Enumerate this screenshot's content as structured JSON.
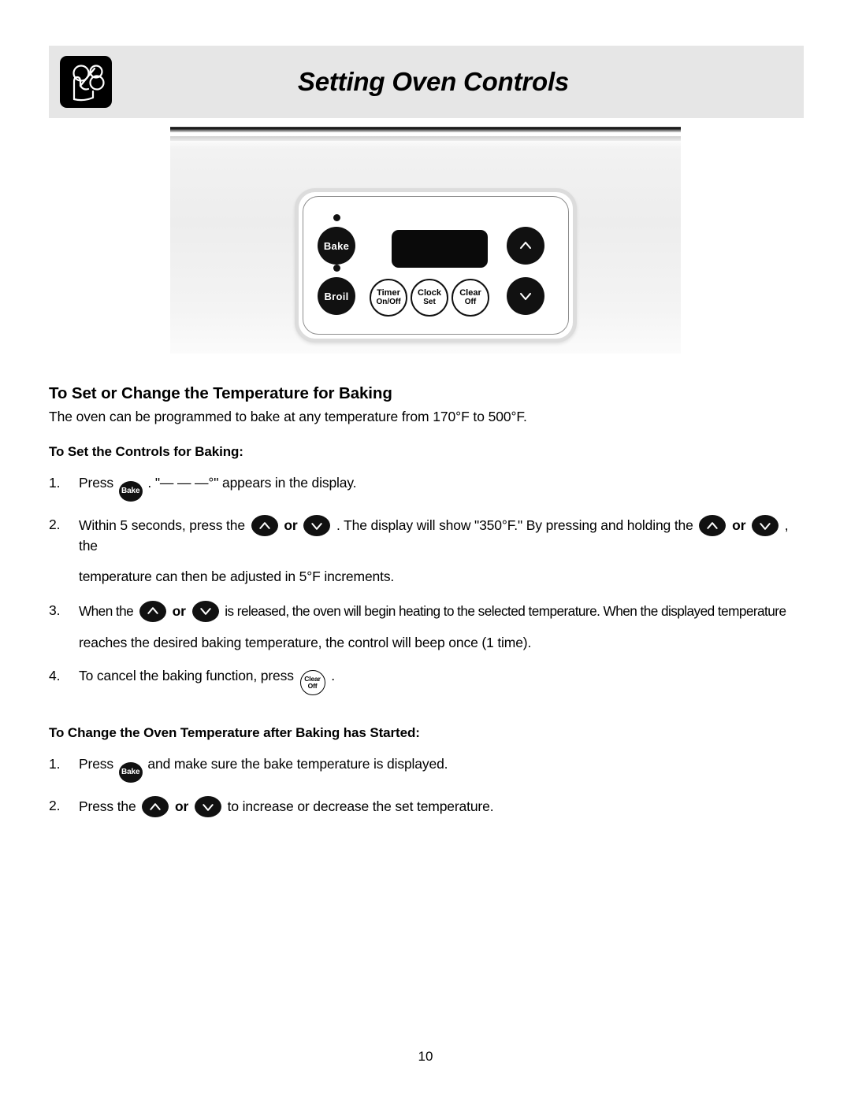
{
  "header": {
    "title": "Setting Oven Controls",
    "icon": "hand-pressing-controls-icon"
  },
  "illustration": {
    "name": "oven-control-panel-illustration",
    "display_value": "",
    "buttons": [
      {
        "id": "bake",
        "label": "Bake",
        "label2": "",
        "style": "dark"
      },
      {
        "id": "broil",
        "label": "Broil",
        "label2": "",
        "style": "dark"
      },
      {
        "id": "timer",
        "label": "Timer",
        "label2": "On/Off",
        "style": "light"
      },
      {
        "id": "clock",
        "label": "Clock",
        "label2": "Set",
        "style": "light"
      },
      {
        "id": "clear",
        "label": "Clear",
        "label2": "Off",
        "style": "light"
      },
      {
        "id": "up-arrow",
        "label": "∧",
        "label2": "",
        "style": "dark"
      },
      {
        "id": "down-arrow",
        "label": "∨",
        "label2": "",
        "style": "dark"
      }
    ]
  },
  "section1": {
    "title": "To Set or Change the Temperature for Baking",
    "lead": "The oven can be programmed to bake at any temperature from 170°F to 500°F.",
    "sub_title": "To Set the Controls for Baking:",
    "steps": [
      {
        "num": "1.",
        "a": "Press",
        "b": ". \"— — —°\" appears in the display."
      },
      {
        "num": "2.",
        "a": "Within 5 seconds, press the",
        "or": "or",
        "b": ". The display will show \"350°F.\" By pressing and holding the",
        "or2": "or",
        "c": ", the",
        "line2": "temperature can then be adjusted in 5°F increments."
      },
      {
        "num": "3.",
        "a": "When the",
        "or": "or",
        "b": "is released, the oven will begin heating to the selected temperature. When the displayed temperature",
        "line2": "reaches the desired baking temperature, the control will beep once (1 time)."
      },
      {
        "num": "4.",
        "a": "To cancel the baking function, press",
        "b": "."
      }
    ]
  },
  "section2": {
    "sub_title": "To Change the Oven Temperature after Baking has Started:",
    "steps": [
      {
        "num": "1.",
        "a": "Press",
        "b": "and make sure the bake temperature is displayed."
      },
      {
        "num": "2.",
        "a": "Press the",
        "or": "or",
        "b": "to increase or decrease the set temperature."
      }
    ]
  },
  "footer": {
    "page_number": "10"
  },
  "colors": {
    "header_band": "#e6e6e6",
    "button_dark": "#111111",
    "text": "#000000",
    "panel_border": "#dcdcdc"
  }
}
